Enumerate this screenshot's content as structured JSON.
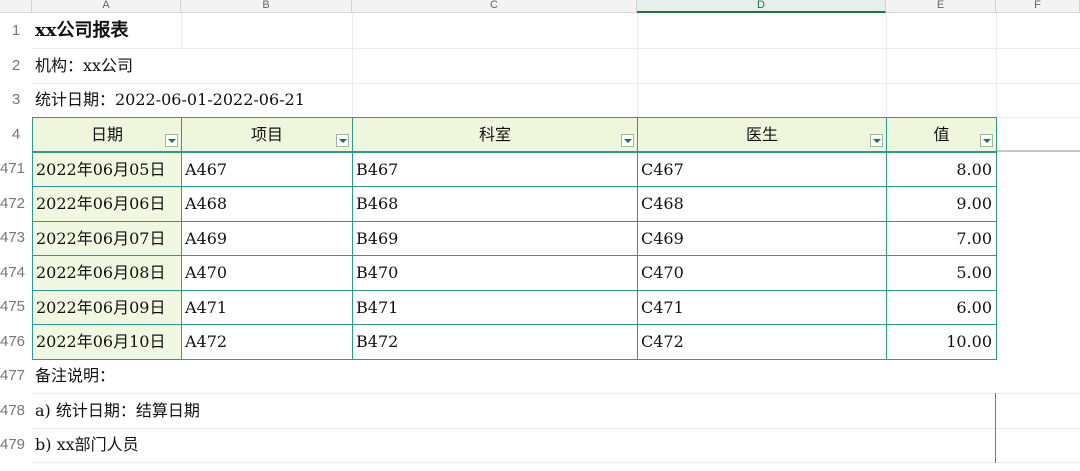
{
  "columns": [
    "A",
    "B",
    "C",
    "D",
    "E",
    "F"
  ],
  "rows": [
    "1",
    "2",
    "3",
    "4",
    "471",
    "472",
    "473",
    "474",
    "475",
    "476",
    "477",
    "478",
    "479"
  ],
  "title": "xx公司报表",
  "org": "机构：xx公司",
  "period": "统计日期：2022-06-01-2022-06-21",
  "headers": [
    "日期",
    "项目",
    "科室",
    "医生",
    "值"
  ],
  "table": [
    [
      "2022年06月05日",
      "A467",
      "B467",
      "C467",
      "8.00"
    ],
    [
      "2022年06月06日",
      "A468",
      "B468",
      "C468",
      "9.00"
    ],
    [
      "2022年06月07日",
      "A469",
      "B469",
      "C469",
      "7.00"
    ],
    [
      "2022年06月08日",
      "A470",
      "B470",
      "C470",
      "5.00"
    ],
    [
      "2022年06月09日",
      "A471",
      "B471",
      "C471",
      "6.00"
    ],
    [
      "2022年06月10日",
      "A472",
      "B472",
      "C472",
      "10.00"
    ]
  ],
  "notes": [
    "备注说明：",
    "a) 统计日期：结算日期",
    "b) xx部门人员"
  ],
  "colors": {
    "accent": "#217346",
    "border": "#2f9a89",
    "header_fill": "#eef6dc",
    "date_fill": "#f1f8e2"
  }
}
